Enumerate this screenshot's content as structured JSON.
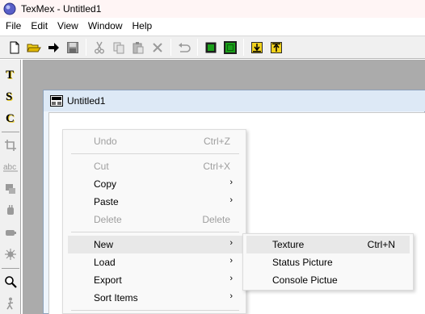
{
  "window": {
    "title": "TexMex - Untitled1"
  },
  "menubar": {
    "items": [
      "File",
      "Edit",
      "View",
      "Window",
      "Help"
    ]
  },
  "toolbar": {
    "buttons": [
      "new-file-icon",
      "open-folder-icon",
      "forward-arrow-icon",
      "save-disk-icon",
      "cut-icon",
      "copy-icon",
      "paste-icon",
      "delete-icon",
      "undo-icon",
      "green-square-icon",
      "green-frame-icon",
      "import-icon",
      "export-icon"
    ]
  },
  "palette": {
    "texture_letter": "T",
    "status_letter": "S",
    "console_letter": "C",
    "abc": "abc"
  },
  "document": {
    "title": "Untitled1"
  },
  "context_menu": {
    "undo": {
      "label": "Undo",
      "shortcut": "Ctrl+Z"
    },
    "cut": {
      "label": "Cut",
      "shortcut": "Ctrl+X"
    },
    "copy": {
      "label": "Copy"
    },
    "paste": {
      "label": "Paste"
    },
    "delete": {
      "label": "Delete",
      "shortcut": "Delete"
    },
    "new": {
      "label": "New"
    },
    "load": {
      "label": "Load"
    },
    "export": {
      "label": "Export"
    },
    "sort_items": {
      "label": "Sort Items"
    },
    "submenu_arrow": "›"
  },
  "new_submenu": {
    "texture": {
      "label": "Texture",
      "shortcut": "Ctrl+N"
    },
    "status_picture": {
      "label": "Status Picture"
    },
    "console_picture": {
      "label": "Console Pictue"
    }
  },
  "colors": {
    "highlight": "#e8e8e8",
    "disabled_text": "#9e9e9e",
    "mdi_background": "#ababab",
    "child_title": "#dde9f6",
    "accent_green": "#1aa01a",
    "accent_yellow": "#f2d21c"
  }
}
